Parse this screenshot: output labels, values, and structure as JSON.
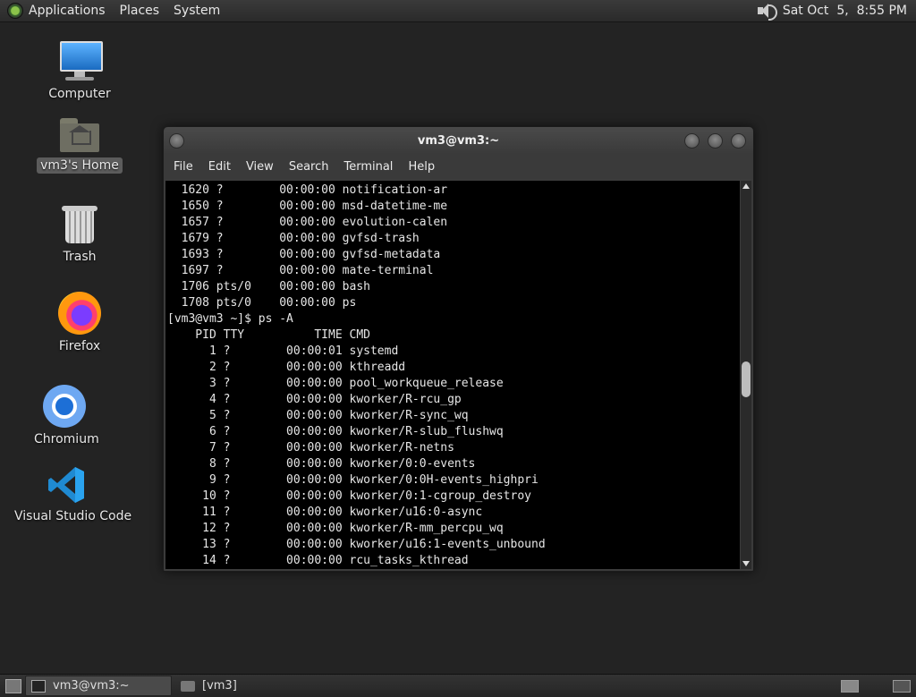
{
  "top_panel": {
    "menus": [
      "Applications",
      "Places",
      "System"
    ],
    "clock": "Sat Oct  5,  8:55 PM"
  },
  "desktop_icons": [
    {
      "label": "Computer",
      "icon": "computer-icon"
    },
    {
      "label": "vm3's Home",
      "icon": "home-folder-icon"
    },
    {
      "label": "Trash",
      "icon": "trash-icon"
    },
    {
      "label": "Firefox",
      "icon": "firefox-icon"
    },
    {
      "label": "Chromium",
      "icon": "chromium-icon"
    },
    {
      "label": "Visual Studio Code",
      "icon": "vscode-icon"
    }
  ],
  "terminal": {
    "title": "vm3@vm3:~",
    "menus": [
      "File",
      "Edit",
      "View",
      "Search",
      "Terminal",
      "Help"
    ],
    "lines": [
      "  1620 ?        00:00:00 notification-ar",
      "  1650 ?        00:00:00 msd-datetime-me",
      "  1657 ?        00:00:00 evolution-calen",
      "  1679 ?        00:00:00 gvfsd-trash",
      "  1693 ?        00:00:00 gvfsd-metadata",
      "  1697 ?        00:00:00 mate-terminal",
      "  1706 pts/0    00:00:00 bash",
      "  1708 pts/0    00:00:00 ps",
      "[vm3@vm3 ~]$ ps -A",
      "    PID TTY          TIME CMD",
      "      1 ?        00:00:01 systemd",
      "      2 ?        00:00:00 kthreadd",
      "      3 ?        00:00:00 pool_workqueue_release",
      "      4 ?        00:00:00 kworker/R-rcu_gp",
      "      5 ?        00:00:00 kworker/R-sync_wq",
      "      6 ?        00:00:00 kworker/R-slub_flushwq",
      "      7 ?        00:00:00 kworker/R-netns",
      "      8 ?        00:00:00 kworker/0:0-events",
      "      9 ?        00:00:00 kworker/0:0H-events_highpri",
      "     10 ?        00:00:00 kworker/0:1-cgroup_destroy",
      "     11 ?        00:00:00 kworker/u16:0-async",
      "     12 ?        00:00:00 kworker/R-mm_percpu_wq",
      "     13 ?        00:00:00 kworker/u16:1-events_unbound",
      "     14 ?        00:00:00 rcu_tasks_kthread"
    ]
  },
  "taskbar": {
    "tasks": [
      "vm3@vm3:~",
      "[vm3]"
    ]
  }
}
